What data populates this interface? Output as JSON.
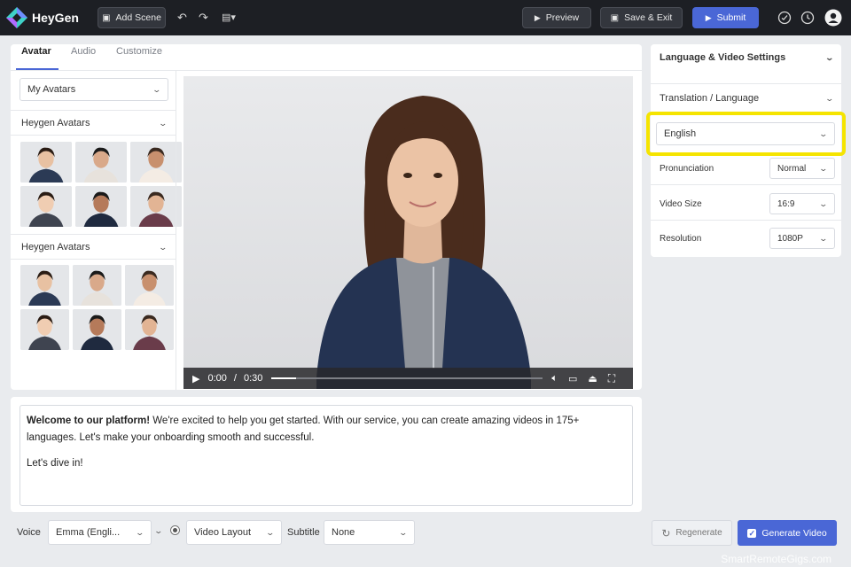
{
  "app": {
    "name": "HeyGen"
  },
  "toolbar": {
    "add_scene": "Add Scene",
    "preview": "Preview",
    "save_exit": "Save & Exit",
    "submit": "Submit"
  },
  "tabs": [
    "Avatar",
    "Audio",
    "Customize"
  ],
  "avatar_panel": {
    "my_avatars": "My Avatars",
    "section1": "Heygen Avatars",
    "section2": "Heygen Avatars"
  },
  "video": {
    "current_time": "0:00",
    "separator": "/",
    "duration": "0:30",
    "progress": 0.09
  },
  "script": {
    "paragraph1_bold1": "Welcome to our ",
    "paragraph1_bold2": "platform!",
    "paragraph1_rest": " We're excited to help you get started. With our service, you can create amazing videos in 175+ languages. Let's make your onboarding smooth and successful.",
    "paragraph2": "Let's dive in!"
  },
  "settings": {
    "header": "Language & Video Settings",
    "translation_label": "Translation / Language",
    "language_value": "English",
    "pronunciation_label": "Pronunciation",
    "pronunciation_value": "Normal",
    "video_size_label": "Video Size",
    "video_size_value": "16:9",
    "resolution_label": "Resolution",
    "resolution_value": "1080P"
  },
  "bottom": {
    "voice_label": "Voice",
    "voice_value": "Emma (Engli...",
    "layout_value": "Video Layout",
    "subtitle_label": "Subtitle",
    "subtitle_value": "None",
    "regenerate": "Regenerate",
    "generate": "Generate Video"
  },
  "watermark": "SmartRemoteGigs.com",
  "colors": {
    "topbar": "#1d1f24",
    "accent": "#4a67d6",
    "highlight": "#f5e400"
  }
}
